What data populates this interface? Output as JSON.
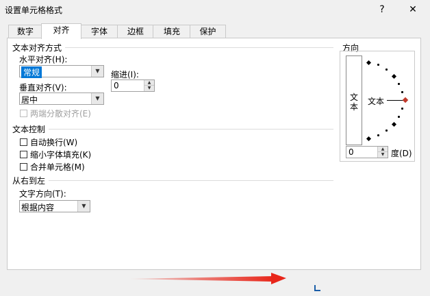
{
  "window": {
    "title": "设置单元格格式",
    "help_label": "?",
    "close_label": "✕"
  },
  "tabs": [
    {
      "label": "数字",
      "active": false
    },
    {
      "label": "对齐",
      "active": true
    },
    {
      "label": "字体",
      "active": false
    },
    {
      "label": "边框",
      "active": false
    },
    {
      "label": "填充",
      "active": false
    },
    {
      "label": "保护",
      "active": false
    }
  ],
  "text_alignment": {
    "group_label": "文本对齐方式",
    "horizontal_label": "水平对齐(H):",
    "horizontal_value": "常规",
    "indent_label": "缩进(I):",
    "indent_value": "0",
    "vertical_label": "垂直对齐(V):",
    "vertical_value": "居中",
    "justify_distributed_label": "两端分散对齐(E)"
  },
  "text_control": {
    "group_label": "文本控制",
    "wrap_text": "自动换行(W)",
    "shrink_to_fit": "缩小字体填充(K)",
    "merge_cells": "合并单元格(M)"
  },
  "rtl": {
    "group_label": "从右到左",
    "direction_label": "文字方向(T):",
    "direction_value": "根据内容"
  },
  "orientation": {
    "group_label": "方向",
    "vertical_text": "文本",
    "horizontal_text": "文本",
    "degree_value": "0",
    "degree_label": "度(D)"
  },
  "colors": {
    "accent_arrow": "#e8261a",
    "selection": "#0078d7",
    "marker": "#c0392b"
  }
}
